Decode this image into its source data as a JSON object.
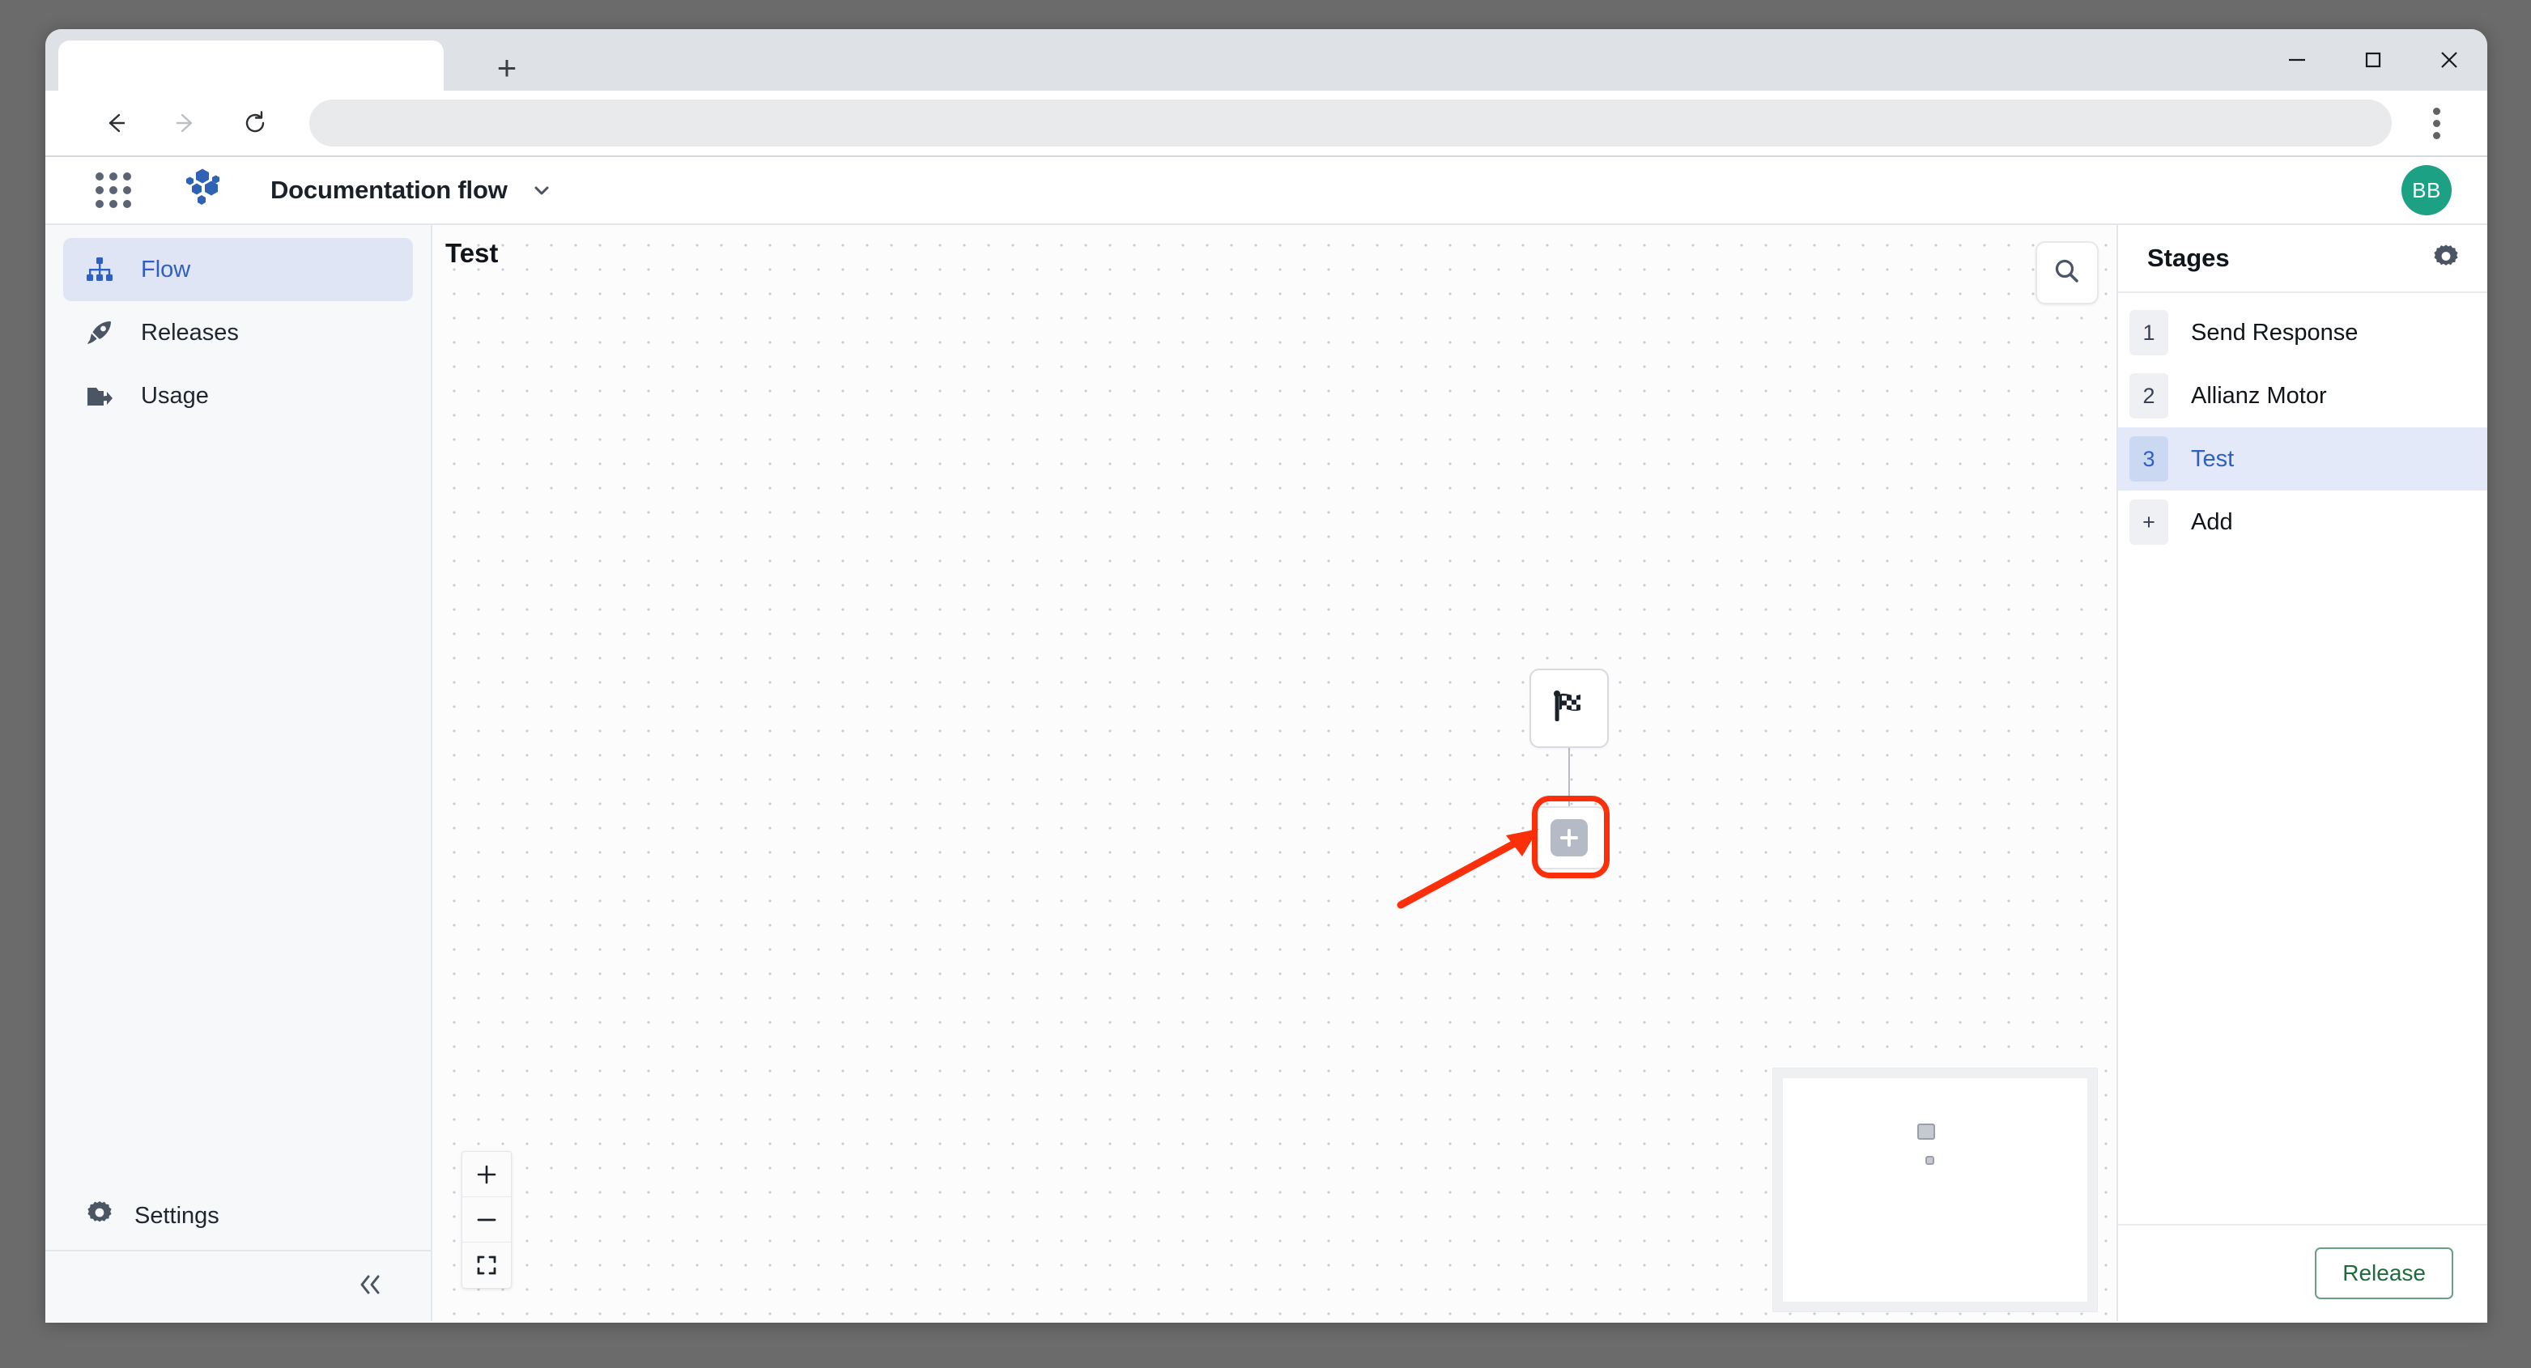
{
  "browser": {
    "tab_title": "",
    "address_value": "",
    "address_placeholder": "",
    "new_tab_label": "+",
    "minimize_label": "Minimize",
    "maximize_label": "Maximize",
    "close_label": "Close",
    "back_label": "Back",
    "forward_label": "Forward",
    "reload_label": "Reload",
    "menu_label": "Customize and control"
  },
  "header": {
    "apps_icon": "grid-apps-icon",
    "logo_icon": "hexagon-cluster-logo",
    "title": "Documentation flow",
    "title_chevron": "chevron-down-icon",
    "avatar_initials": "BB",
    "avatar_color": "#1da184"
  },
  "sidebar": {
    "items": [
      {
        "label": "Flow",
        "icon": "hierarchy-icon",
        "active": true
      },
      {
        "label": "Releases",
        "icon": "rocket-icon",
        "active": false
      },
      {
        "label": "Usage",
        "icon": "folder-arrow-icon",
        "active": false
      }
    ],
    "settings": {
      "label": "Settings",
      "icon": "gear-icon"
    },
    "collapse_icon": "double-chevron-left-icon",
    "active_color": "#2f5fc0"
  },
  "canvas": {
    "title": "Test",
    "search_icon": "search-icon",
    "nodes": [
      {
        "id": "end",
        "icon": "checkered-flag-icon",
        "label": ""
      },
      {
        "id": "add",
        "icon": "plus-icon",
        "label": ""
      }
    ],
    "annotation": {
      "highlight_color": "#fb2f0a",
      "arrow_color": "#fb2f0a",
      "target": "add-node"
    },
    "zoom_controls": [
      {
        "name": "zoom-in-button",
        "icon": "plus-icon"
      },
      {
        "name": "zoom-out-button",
        "icon": "minus-icon"
      },
      {
        "name": "fit-view-button",
        "icon": "fit-screen-icon"
      }
    ],
    "minimap": {
      "name": "minimap",
      "node_count": 2
    }
  },
  "stages_panel": {
    "title": "Stages",
    "gear_icon": "gear-icon",
    "items": [
      {
        "num": "1",
        "label": "Send Response",
        "active": false
      },
      {
        "num": "2",
        "label": "Allianz Motor",
        "active": false
      },
      {
        "num": "3",
        "label": "Test",
        "active": true
      },
      {
        "num": "+",
        "label": "Add",
        "active": false
      }
    ],
    "release_button": "Release",
    "release_color": "#1f6b3d"
  }
}
